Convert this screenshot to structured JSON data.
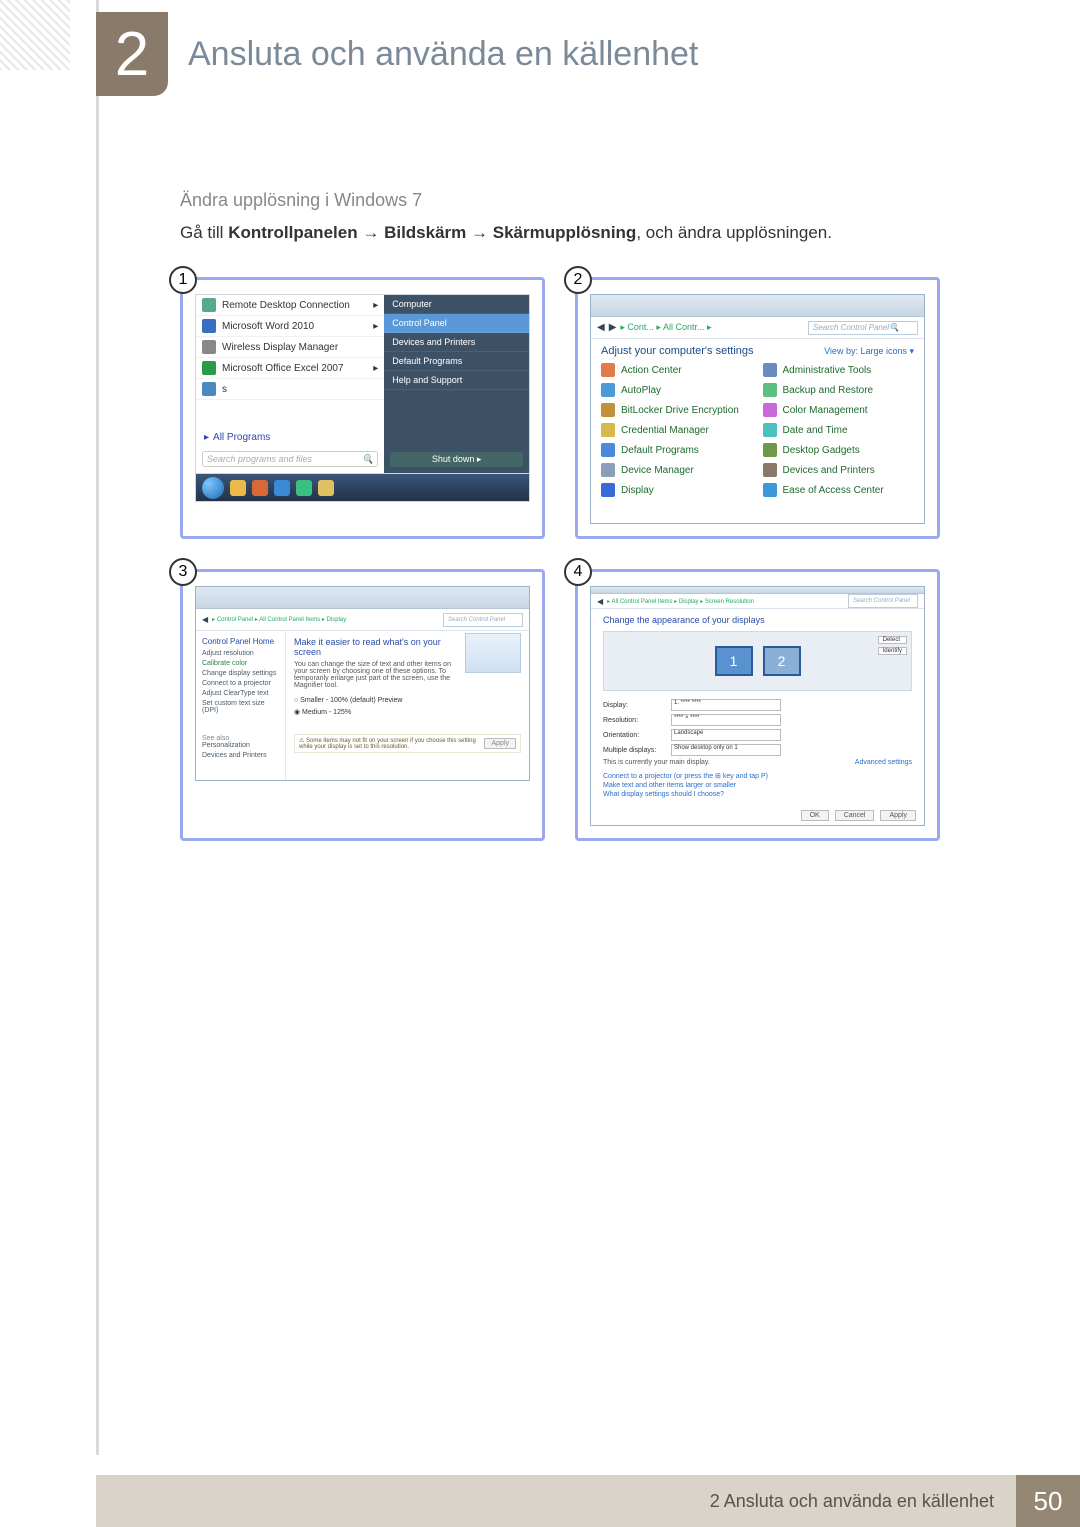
{
  "chapter": {
    "number": "2",
    "title": "Ansluta och använda en källenhet"
  },
  "section": {
    "label": "Ändra upplösning i Windows 7",
    "text_prefix": "Gå till ",
    "path1": "Kontrollpanelen",
    "arrow": "→",
    "path2": "Bildskärm",
    "path3": "Skärmupplösning",
    "text_suffix": ", och ändra upplösningen."
  },
  "panel1": {
    "num": "1",
    "left_items": [
      "Remote Desktop Connection",
      "Microsoft Word 2010",
      "Wireless Display Manager",
      "Microsoft Office Excel 2007",
      "s"
    ],
    "all_programs": "All Programs",
    "search": "Search programs and files",
    "right_items": [
      "Computer",
      "Control Panel",
      "Devices and Printers",
      "Default Programs",
      "Help and Support"
    ],
    "shutdown": "Shut down"
  },
  "panel2": {
    "num": "2",
    "crumbs": "▸ Cont... ▸ All Contr... ▸",
    "search": "Search Control Panel",
    "headline": "Adjust your computer's settings",
    "view": "View by:   Large icons ▾",
    "items_left": [
      "Action Center",
      "AutoPlay",
      "BitLocker Drive Encryption",
      "Credential Manager",
      "Default Programs",
      "Device Manager",
      "Display"
    ],
    "items_right": [
      "Administrative Tools",
      "Backup and Restore",
      "Color Management",
      "Date and Time",
      "Desktop Gadgets",
      "Devices and Printers",
      "Ease of Access Center"
    ]
  },
  "panel3": {
    "num": "3",
    "crumbs": "▸ Control Panel ▸ All Control Panel Items ▸ Display",
    "search": "Search Control Panel",
    "side_head": "Control Panel Home",
    "side_items": [
      "Adjust resolution",
      "Calibrate color",
      "Change display settings",
      "Connect to a projector",
      "Adjust ClearType text",
      "Set custom text size (DPI)"
    ],
    "see_also": "See also",
    "see_items": [
      "Personalization",
      "Devices and Printers"
    ],
    "main_head": "Make it easier to read what's on your screen",
    "main_desc": "You can change the size of text and other items on your screen by choosing one of these options. To temporarily enlarge just part of the screen, use the Magnifier tool.",
    "radio1": "○ Smaller - 100% (default)    Preview",
    "radio2": "◉ Medium - 125%",
    "note": "⚠ Some items may not fit on your screen if you choose this setting while your display is set to this resolution.",
    "apply": "Apply"
  },
  "panel4": {
    "num": "4",
    "crumbs": "▸ All Control Panel Items ▸ Display ▸ Screen Resolution",
    "search": "Search Control Panel",
    "headline": "Change the appearance of your displays",
    "mon1": "1",
    "mon2": "2",
    "btn_detect": "Detect",
    "btn_identify": "Identify",
    "rows": {
      "display": "Display:",
      "display_v": "1. **** ****",
      "resolution": "Resolution:",
      "resolution_v": "**** × ****",
      "orientation": "Orientation:",
      "orientation_v": "Landscape",
      "multiple": "Multiple displays:",
      "multiple_v": "Show desktop only on 1"
    },
    "main_note": "This is currently your main display.",
    "adv": "Advanced settings",
    "link1": "Connect to a projector (or press the ⊞ key and tap P)",
    "link2": "Make text and other items larger or smaller",
    "link3": "What display settings should I choose?",
    "ok": "OK",
    "cancel": "Cancel",
    "apply": "Apply"
  },
  "footer": {
    "text": "2 Ansluta och använda en källenhet",
    "page": "50"
  }
}
